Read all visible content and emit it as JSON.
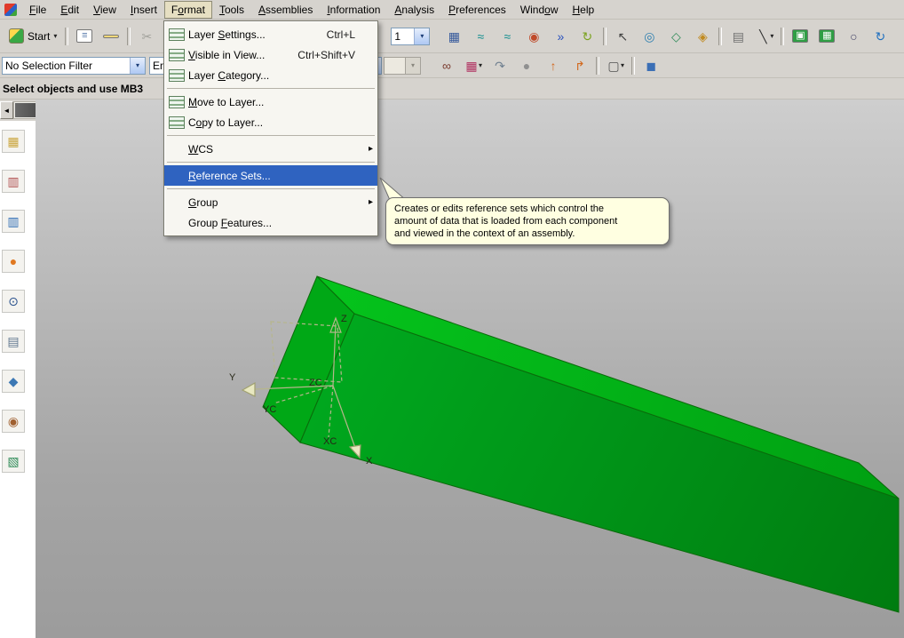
{
  "icons": {
    "caret": "▾",
    "submenu_arrow": "▸",
    "scroll_left": "◄",
    "scroll_right": "►"
  },
  "colors": {
    "selection_highlight": "#2f63c0",
    "tooltip_bg": "#ffffe1",
    "block_green": "#00a81e"
  },
  "menubar": {
    "items": [
      {
        "name": "menubar-file",
        "label": "File",
        "u": 0
      },
      {
        "name": "menubar-edit",
        "label": "Edit",
        "u": 0
      },
      {
        "name": "menubar-view",
        "label": "View",
        "u": 0
      },
      {
        "name": "menubar-insert",
        "label": "Insert",
        "u": 0
      },
      {
        "name": "menubar-format",
        "label": "Format",
        "u": 1,
        "active": true
      },
      {
        "name": "menubar-tools",
        "label": "Tools",
        "u": 0
      },
      {
        "name": "menubar-assemblies",
        "label": "Assemblies",
        "u": 0
      },
      {
        "name": "menubar-information",
        "label": "Information",
        "u": 0
      },
      {
        "name": "menubar-analysis",
        "label": "Analysis",
        "u": 0
      },
      {
        "name": "menubar-preferences",
        "label": "Preferences",
        "u": 0
      },
      {
        "name": "menubar-window",
        "label": "Window",
        "u": 4
      },
      {
        "name": "menubar-help",
        "label": "Help",
        "u": 0
      }
    ]
  },
  "toolbar1": {
    "start_label": "Start",
    "layer_value": "1",
    "buttons_left": [
      {
        "name": "new-part-button",
        "glyph": "≡",
        "color": "#5577aa",
        "bg": "#ffffff"
      },
      {
        "name": "open-part-button",
        "glyph": "",
        "color": "#8a6d1a",
        "bg": "#f5d97a"
      },
      {
        "type": "sep"
      },
      {
        "name": "cut-button",
        "glyph": "✂",
        "color": "#a0a09a"
      }
    ],
    "buttons_right": [
      {
        "name": "spreadsheet-button",
        "glyph": "▦",
        "color": "#35599c"
      },
      {
        "name": "sketch-tool-button",
        "glyph": "≈",
        "color": "#0e8d8d"
      },
      {
        "name": "surface-tool-button",
        "glyph": "≈",
        "color": "#0e8d8d"
      },
      {
        "name": "shaded-ball-button",
        "glyph": "◉",
        "color": "#c04a2a"
      },
      {
        "name": "blue-arrows-button",
        "glyph": "»",
        "color": "#2a52be"
      },
      {
        "name": "green-swoosh-button",
        "glyph": "↻",
        "color": "#7aa21e"
      },
      {
        "type": "sep"
      },
      {
        "name": "cursor-button",
        "glyph": "↖",
        "color": "#404040"
      },
      {
        "name": "circle-tool-button",
        "glyph": "◎",
        "color": "#2e7fb0"
      },
      {
        "name": "diamond-tool-button",
        "glyph": "◇",
        "color": "#2e8b57"
      },
      {
        "name": "gold-tool-button",
        "glyph": "◈",
        "color": "#c08a20"
      },
      {
        "type": "sep"
      },
      {
        "name": "ruler-button",
        "glyph": "▤",
        "color": "#707070"
      },
      {
        "name": "line-width-button",
        "glyph": "╲",
        "color": "#303030",
        "caret": true
      },
      {
        "type": "sep"
      },
      {
        "name": "fit-view-button",
        "glyph": "▣",
        "color": "#ffffff",
        "bg": "#2f9e44"
      },
      {
        "name": "zoom-window-button",
        "glyph": "▦",
        "color": "#ffffff",
        "bg": "#2f9e44"
      },
      {
        "name": "zoom-button",
        "glyph": "○",
        "color": "#444466"
      },
      {
        "name": "rotate-view-button",
        "glyph": "↻",
        "color": "#1f6fbf"
      }
    ]
  },
  "toolbar2": {
    "selection_filter_value": "No Selection Filter",
    "scope_value": "En",
    "buttons": [
      {
        "name": "binoculars-button",
        "glyph": "∞",
        "color": "#7a3b2e"
      },
      {
        "name": "color-filter-button",
        "glyph": "▦",
        "color": "#b03060",
        "caret": true
      },
      {
        "name": "curved-arrow-button",
        "glyph": "↷",
        "color": "#708090"
      },
      {
        "name": "shaded-sphere-button",
        "glyph": "●",
        "color": "#909090"
      },
      {
        "name": "arrow-up-button",
        "glyph": "↑",
        "color": "#d2691e"
      },
      {
        "name": "arrow-corner-button",
        "glyph": "↱",
        "color": "#d2691e"
      },
      {
        "type": "sep"
      },
      {
        "name": "select-rect-button",
        "glyph": "▢",
        "color": "#505050",
        "caret": true
      },
      {
        "type": "sep"
      },
      {
        "name": "shaded-cube-button",
        "glyph": "◼",
        "color": "#3b6fb5"
      }
    ]
  },
  "cue": {
    "text": "Select objects and use MB3"
  },
  "resource_bar": {
    "items": [
      {
        "name": "assembly-navigator-icon",
        "glyph": "▦",
        "color": "#caa53c"
      },
      {
        "name": "constraint-navigator-icon",
        "glyph": "▥",
        "color": "#b05050"
      },
      {
        "name": "part-navigator-icon",
        "glyph": "▥",
        "color": "#2f6db5"
      },
      {
        "name": "reuse-library-icon",
        "glyph": "●",
        "color": "#e07820"
      },
      {
        "name": "history-icon",
        "glyph": "⊙",
        "color": "#28508c"
      },
      {
        "name": "information-palette-icon",
        "glyph": "▤",
        "color": "#607890"
      },
      {
        "name": "tools-palette-icon",
        "glyph": "◆",
        "color": "#3c78b4"
      },
      {
        "name": "roles-icon",
        "glyph": "◉",
        "color": "#a06030"
      },
      {
        "name": "scene-palette-icon",
        "glyph": "▧",
        "color": "#2e8b57"
      }
    ]
  },
  "format_menu": {
    "items": [
      {
        "name": "menu-item-layer-settings",
        "label": "Layer Settings...",
        "u": 6,
        "shortcut": "Ctrl+L",
        "icon": "icon-layers"
      },
      {
        "name": "menu-item-visible-in-view",
        "label": "Visible in View...",
        "u": 0,
        "shortcut": "Ctrl+Shift+V",
        "icon": "icon-layers"
      },
      {
        "name": "menu-item-layer-category",
        "label": "Layer Category...",
        "u": 6,
        "icon": "icon-layers"
      },
      {
        "type": "sep"
      },
      {
        "name": "menu-item-move-to-layer",
        "label": "Move to Layer...",
        "u": 0,
        "icon": "icon-layers"
      },
      {
        "name": "menu-item-copy-to-layer",
        "label": "Copy to Layer...",
        "u": 1,
        "icon": "icon-layers"
      },
      {
        "type": "sep"
      },
      {
        "name": "menu-item-wcs",
        "label": "WCS",
        "u": 0,
        "submenu": true
      },
      {
        "type": "sep"
      },
      {
        "name": "menu-item-reference-sets",
        "label": "Reference Sets...",
        "u": 0,
        "selected": true
      },
      {
        "type": "sep"
      },
      {
        "name": "menu-item-group",
        "label": "Group",
        "u": 0,
        "submenu": true
      },
      {
        "name": "menu-item-group-features",
        "label": "Group Features...",
        "u": 6
      }
    ]
  },
  "tooltip": {
    "lines": [
      "Creates or edits reference sets which control the",
      "amount of data that is loaded from each component",
      "and viewed in the context of an assembly."
    ]
  },
  "wcs": {
    "z": "Z",
    "y": "Y",
    "x": "X",
    "zc": "ZC",
    "yc": "YC",
    "xc": "XC"
  }
}
